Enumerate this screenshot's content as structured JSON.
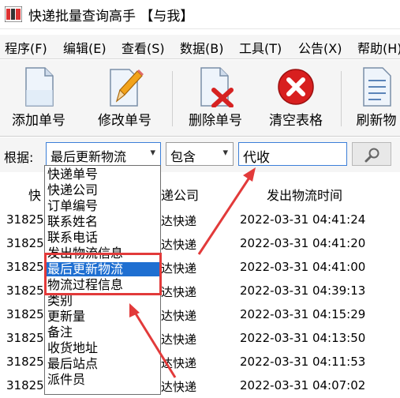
{
  "app": {
    "title": "快递批量查询高手 【与我】"
  },
  "menu": [
    "程序(F)",
    "编辑(E)",
    "查看(S)",
    "数据(B)",
    "工具(T)",
    "公告(X)",
    "帮助(H)"
  ],
  "toolbar": {
    "add": "添加单号",
    "edit": "修改单号",
    "delete": "删除单号",
    "clear": "清空表格",
    "refresh": "刷新物"
  },
  "search": {
    "label": "根据:",
    "field": "最后更新物流",
    "match": "包含",
    "keyword": "代收"
  },
  "table": {
    "headers": [
      "快",
      "递公司",
      "发出物流时间"
    ],
    "rows": [
      [
        "31825",
        "达快递",
        "2022-03-31 04:41:24"
      ],
      [
        "31825",
        "达快递",
        "2022-03-31 04:41:20"
      ],
      [
        "31825",
        "达快递",
        "2022-03-31 04:41:00"
      ],
      [
        "31825",
        "达快递",
        "2022-03-31 04:39:13"
      ],
      [
        "31825",
        "达快递",
        "2022-03-31 04:15:29"
      ],
      [
        "31825",
        "达快递",
        "2022-03-31 04:13:50"
      ],
      [
        "31825",
        "达快递",
        "2022-03-31 04:11:53"
      ],
      [
        "31825",
        "达快递",
        "2022-03-31 04:07:02"
      ]
    ]
  },
  "dropdown": {
    "items": [
      "快递单号",
      "快递公司",
      "订单编号",
      "联系姓名",
      "联系电话",
      "发出物流信息",
      "最后更新物流",
      "物流过程信息",
      "类别",
      "更新量",
      "备注",
      "收货地址",
      "最后站点",
      "派件员"
    ],
    "selected_index": 6
  },
  "colors": {
    "selection": "#1f6fd1",
    "annotation": "#e23a3a",
    "focus": "#3c7fd8"
  }
}
